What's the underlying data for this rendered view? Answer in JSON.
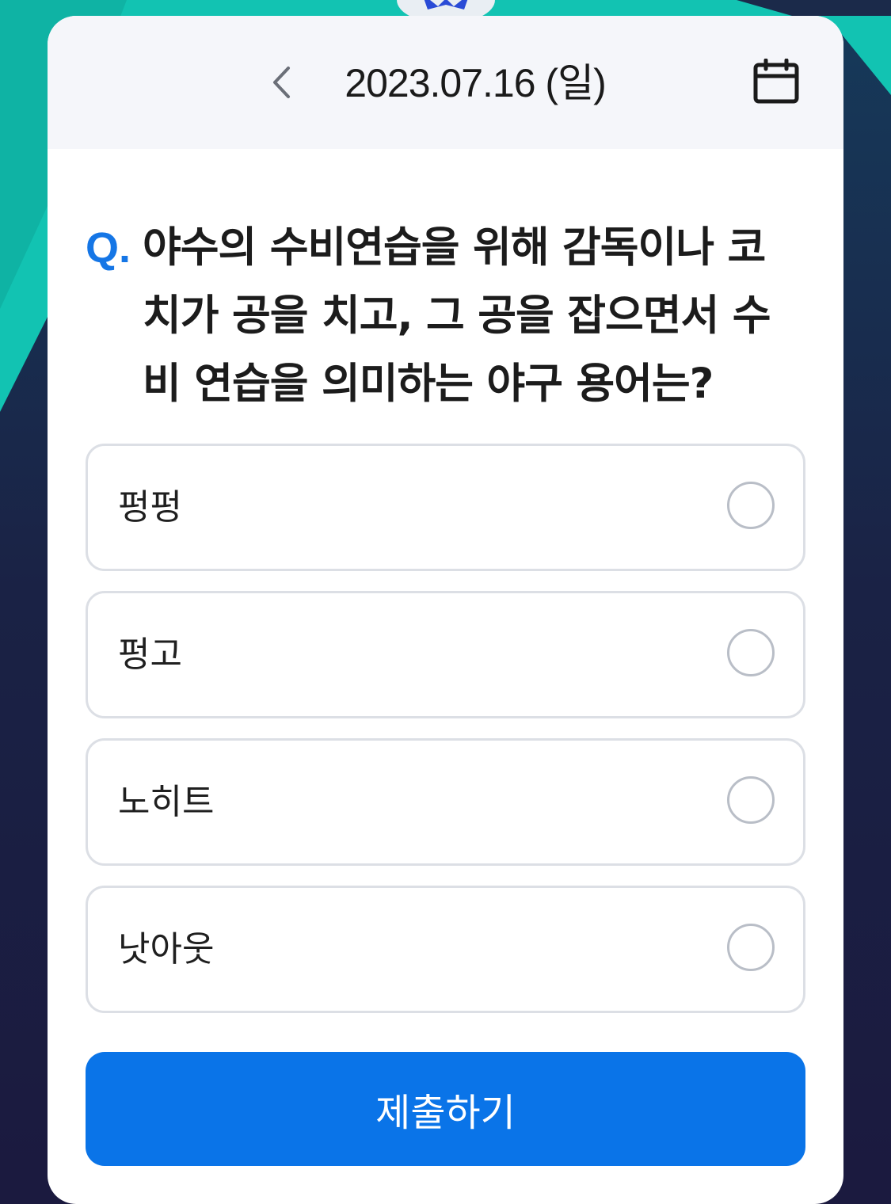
{
  "header": {
    "date": "2023.07.16 (일)",
    "prev_icon": "chevron-left-icon",
    "calendar_icon": "calendar-icon"
  },
  "question": {
    "marker": "Q.",
    "text": "야수의 수비연습을 위해 감독이나 코치가 공을 치고, 그 공을 잡으면서 수비 연습을 의미하는 야구 용어는?"
  },
  "options": [
    {
      "label": "펑펑"
    },
    {
      "label": "펑고"
    },
    {
      "label": "노히트"
    },
    {
      "label": "낫아웃"
    }
  ],
  "submit_label": "제출하기",
  "colors": {
    "accent": "#0a74e8",
    "question_marker": "#1576e6",
    "background_teal": "#12c3b2",
    "background_navy": "#1b1a3f"
  }
}
